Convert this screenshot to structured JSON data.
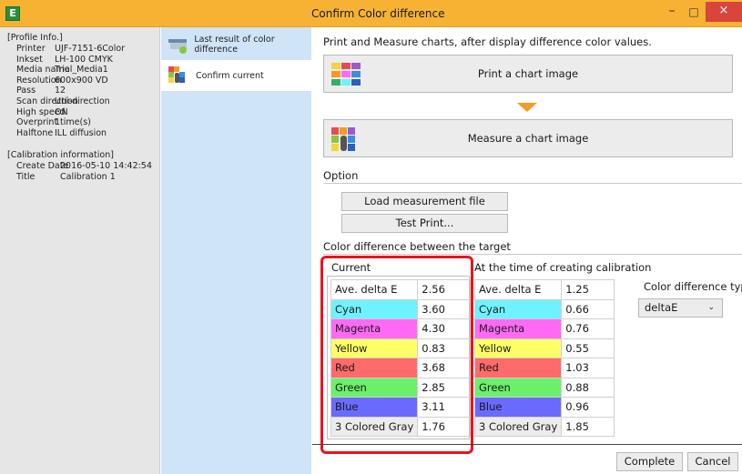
{
  "window": {
    "title": "Confirm Color difference",
    "app_icon_letter": "E",
    "minimize_glyph": "–",
    "maximize_glyph": "□",
    "close_glyph": "×",
    "accent_color": "#f7b233",
    "close_color": "#d9443b"
  },
  "profile": {
    "header": "[Profile Info.]",
    "rows": [
      {
        "key": "Printer",
        "value": "UJF-7151-6Color"
      },
      {
        "key": "Inkset",
        "value": "LH-100 CMYK"
      },
      {
        "key": "Media name",
        "value": "Trial_Media1"
      },
      {
        "key": "Resolution",
        "value": "600x900 VD"
      },
      {
        "key": "Pass",
        "value": "12"
      },
      {
        "key": "Scan direction",
        "value": "Uni-direction"
      },
      {
        "key": "High speed",
        "value": "ON"
      },
      {
        "key": "Overprint",
        "value": "1time(s)"
      },
      {
        "key": "Halftone",
        "value": "ILL diffusion"
      }
    ],
    "calib_header": "[Calibration information]",
    "calib_rows": [
      {
        "key": "Create Date",
        "value": "2016-05-10 14:42:54"
      },
      {
        "key": "Title",
        "value": "Calibration 1"
      }
    ]
  },
  "nav": {
    "items": [
      {
        "label": "Last result of color difference",
        "icon": "printer-icon"
      },
      {
        "label": "Confirm current",
        "icon": "measure-icon"
      }
    ]
  },
  "main": {
    "intro": "Print and Measure charts, after display difference color values.",
    "print_button": "Print a chart image",
    "measure_button": "Measure a chart image",
    "option_label": "Option",
    "load_button": "Load measurement file",
    "test_print_button": "Test Print...",
    "cd_label": "Color difference between the target",
    "current": {
      "title": "Current",
      "rows": [
        {
          "name": "Ave. delta E",
          "value": "2.56"
        },
        {
          "name": "Cyan",
          "value": "3.60"
        },
        {
          "name": "Magenta",
          "value": "4.30"
        },
        {
          "name": "Yellow",
          "value": "0.83"
        },
        {
          "name": "Red",
          "value": "3.68"
        },
        {
          "name": "Green",
          "value": "2.85"
        },
        {
          "name": "Blue",
          "value": "3.11"
        },
        {
          "name": "3 Colored Gray",
          "value": "1.76"
        }
      ]
    },
    "calibration": {
      "title": "At the time of creating calibration",
      "rows": [
        {
          "name": "Ave. delta E",
          "value": "1.25"
        },
        {
          "name": "Cyan",
          "value": "0.66"
        },
        {
          "name": "Magenta",
          "value": "0.76"
        },
        {
          "name": "Yellow",
          "value": "0.55"
        },
        {
          "name": "Red",
          "value": "1.03"
        },
        {
          "name": "Green",
          "value": "0.88"
        },
        {
          "name": "Blue",
          "value": "0.96"
        },
        {
          "name": "3 Colored Gray",
          "value": "1.85"
        }
      ]
    },
    "cd_type_label": "Color difference type",
    "cd_type_value": "deltaE",
    "cd_type_chevron": "⌄",
    "complete_button": "Complete",
    "cancel_button": "Cancel"
  }
}
